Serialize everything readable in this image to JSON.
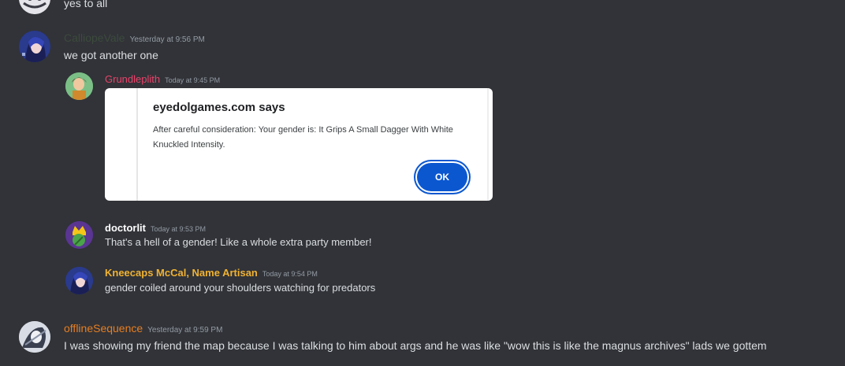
{
  "messages": {
    "top_partial": {
      "text": "yes to all"
    },
    "calliope": {
      "author": "CalliopeVale",
      "author_color": "#3c4a3c",
      "timestamp": "Yesterday at 9:56 PM",
      "text": "we got another one"
    },
    "forwarded": [
      {
        "author": "Grundleplith",
        "author_color": "#e8436a",
        "timestamp": "Today at 9:45 PM",
        "embed": {
          "title": "eyedolgames.com says",
          "body": "After careful consideration: Your gender is: It Grips A Small Dagger With White Knuckled Intensity.",
          "button": "OK"
        }
      },
      {
        "author": "doctorlit",
        "author_color": "#ffffff",
        "timestamp": "Today at 9:53 PM",
        "text": "That's a hell of a gender!  Like a whole extra party member!"
      },
      {
        "author": "Kneecaps McCal, Name Artisan",
        "author_color": "#f0b232",
        "timestamp": "Today at 9:54 PM",
        "text": "gender coiled around your shoulders watching for predators"
      }
    ],
    "offline": {
      "author": "offlineSequence",
      "author_color": "#e67e22",
      "timestamp": "Yesterday at 9:59 PM",
      "text": "I was showing my friend the map because I was talking to him about args and he was like \"wow this is like the magnus archives\" lads we gottem"
    }
  },
  "colors": {
    "background": "#313338",
    "text": "#dbdee1",
    "timestamp": "#949ba4",
    "ok_button": "#0b57d0"
  }
}
